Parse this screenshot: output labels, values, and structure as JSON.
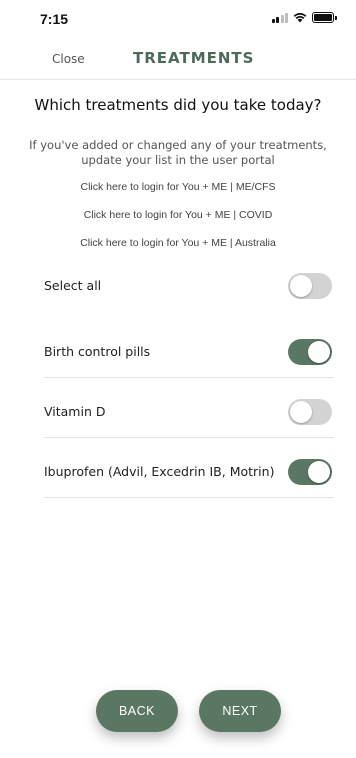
{
  "status_bar": {
    "time": "7:15"
  },
  "header": {
    "close_label": "Close",
    "title": "TREATMENTS"
  },
  "question": "Which treatments did you take today?",
  "info_text": "If you've added or changed any of your treatments, update your list in the user portal",
  "login_links": [
    "Click here to login for You + ME | ME/CFS",
    "Click here to login for You + ME | COVID",
    "Click here to login for You + ME | Australia"
  ],
  "select_all": {
    "label": "Select all",
    "on": false
  },
  "treatments": [
    {
      "label": "Birth control pills",
      "on": true
    },
    {
      "label": "Vitamin D",
      "on": false
    },
    {
      "label": "Ibuprofen (Advil, Excedrin IB, Motrin)",
      "on": true
    }
  ],
  "buttons": {
    "back": "BACK",
    "next": "NEXT"
  },
  "colors": {
    "accent": "#5a7763",
    "toggle_off": "#d3d3d3",
    "title": "#4b6a57"
  }
}
